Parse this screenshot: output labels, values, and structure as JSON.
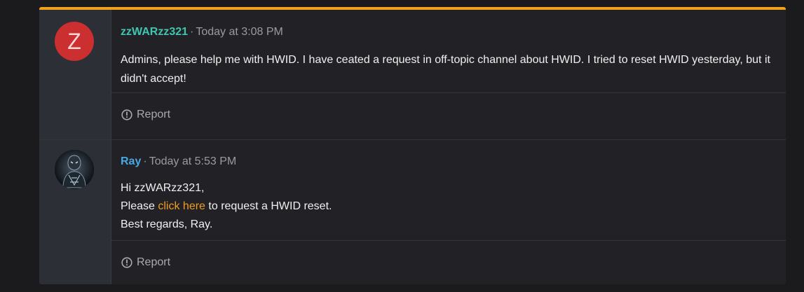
{
  "posts": [
    {
      "avatar_letter": "Z",
      "username": "zzWARzz321",
      "separator": "·",
      "time": "Today at 3:08 PM",
      "content": [
        "Admins, please help me with HWID. I have ceated a request in off-topic channel about HWID. I tried to reset HWID yesterday, but it didn't accept!"
      ],
      "report_label": "Report",
      "report_icon": "info-circle-icon",
      "username_color": "#3ec6b0"
    },
    {
      "avatar": "user-avatar-image",
      "username": "Ray",
      "separator": "·",
      "time": "Today at 5:53 PM",
      "greeting": "Hi zzWARzz321,",
      "line2_before": "Please ",
      "line2_link": "click here",
      "line2_after": " to request a HWID reset.",
      "signoff": "Best regards, Ray.",
      "report_label": "Report",
      "report_icon": "info-circle-icon",
      "username_color": "#48a8e6",
      "link_color": "#f39c1e"
    }
  ],
  "accent_color": "#f0a21a"
}
